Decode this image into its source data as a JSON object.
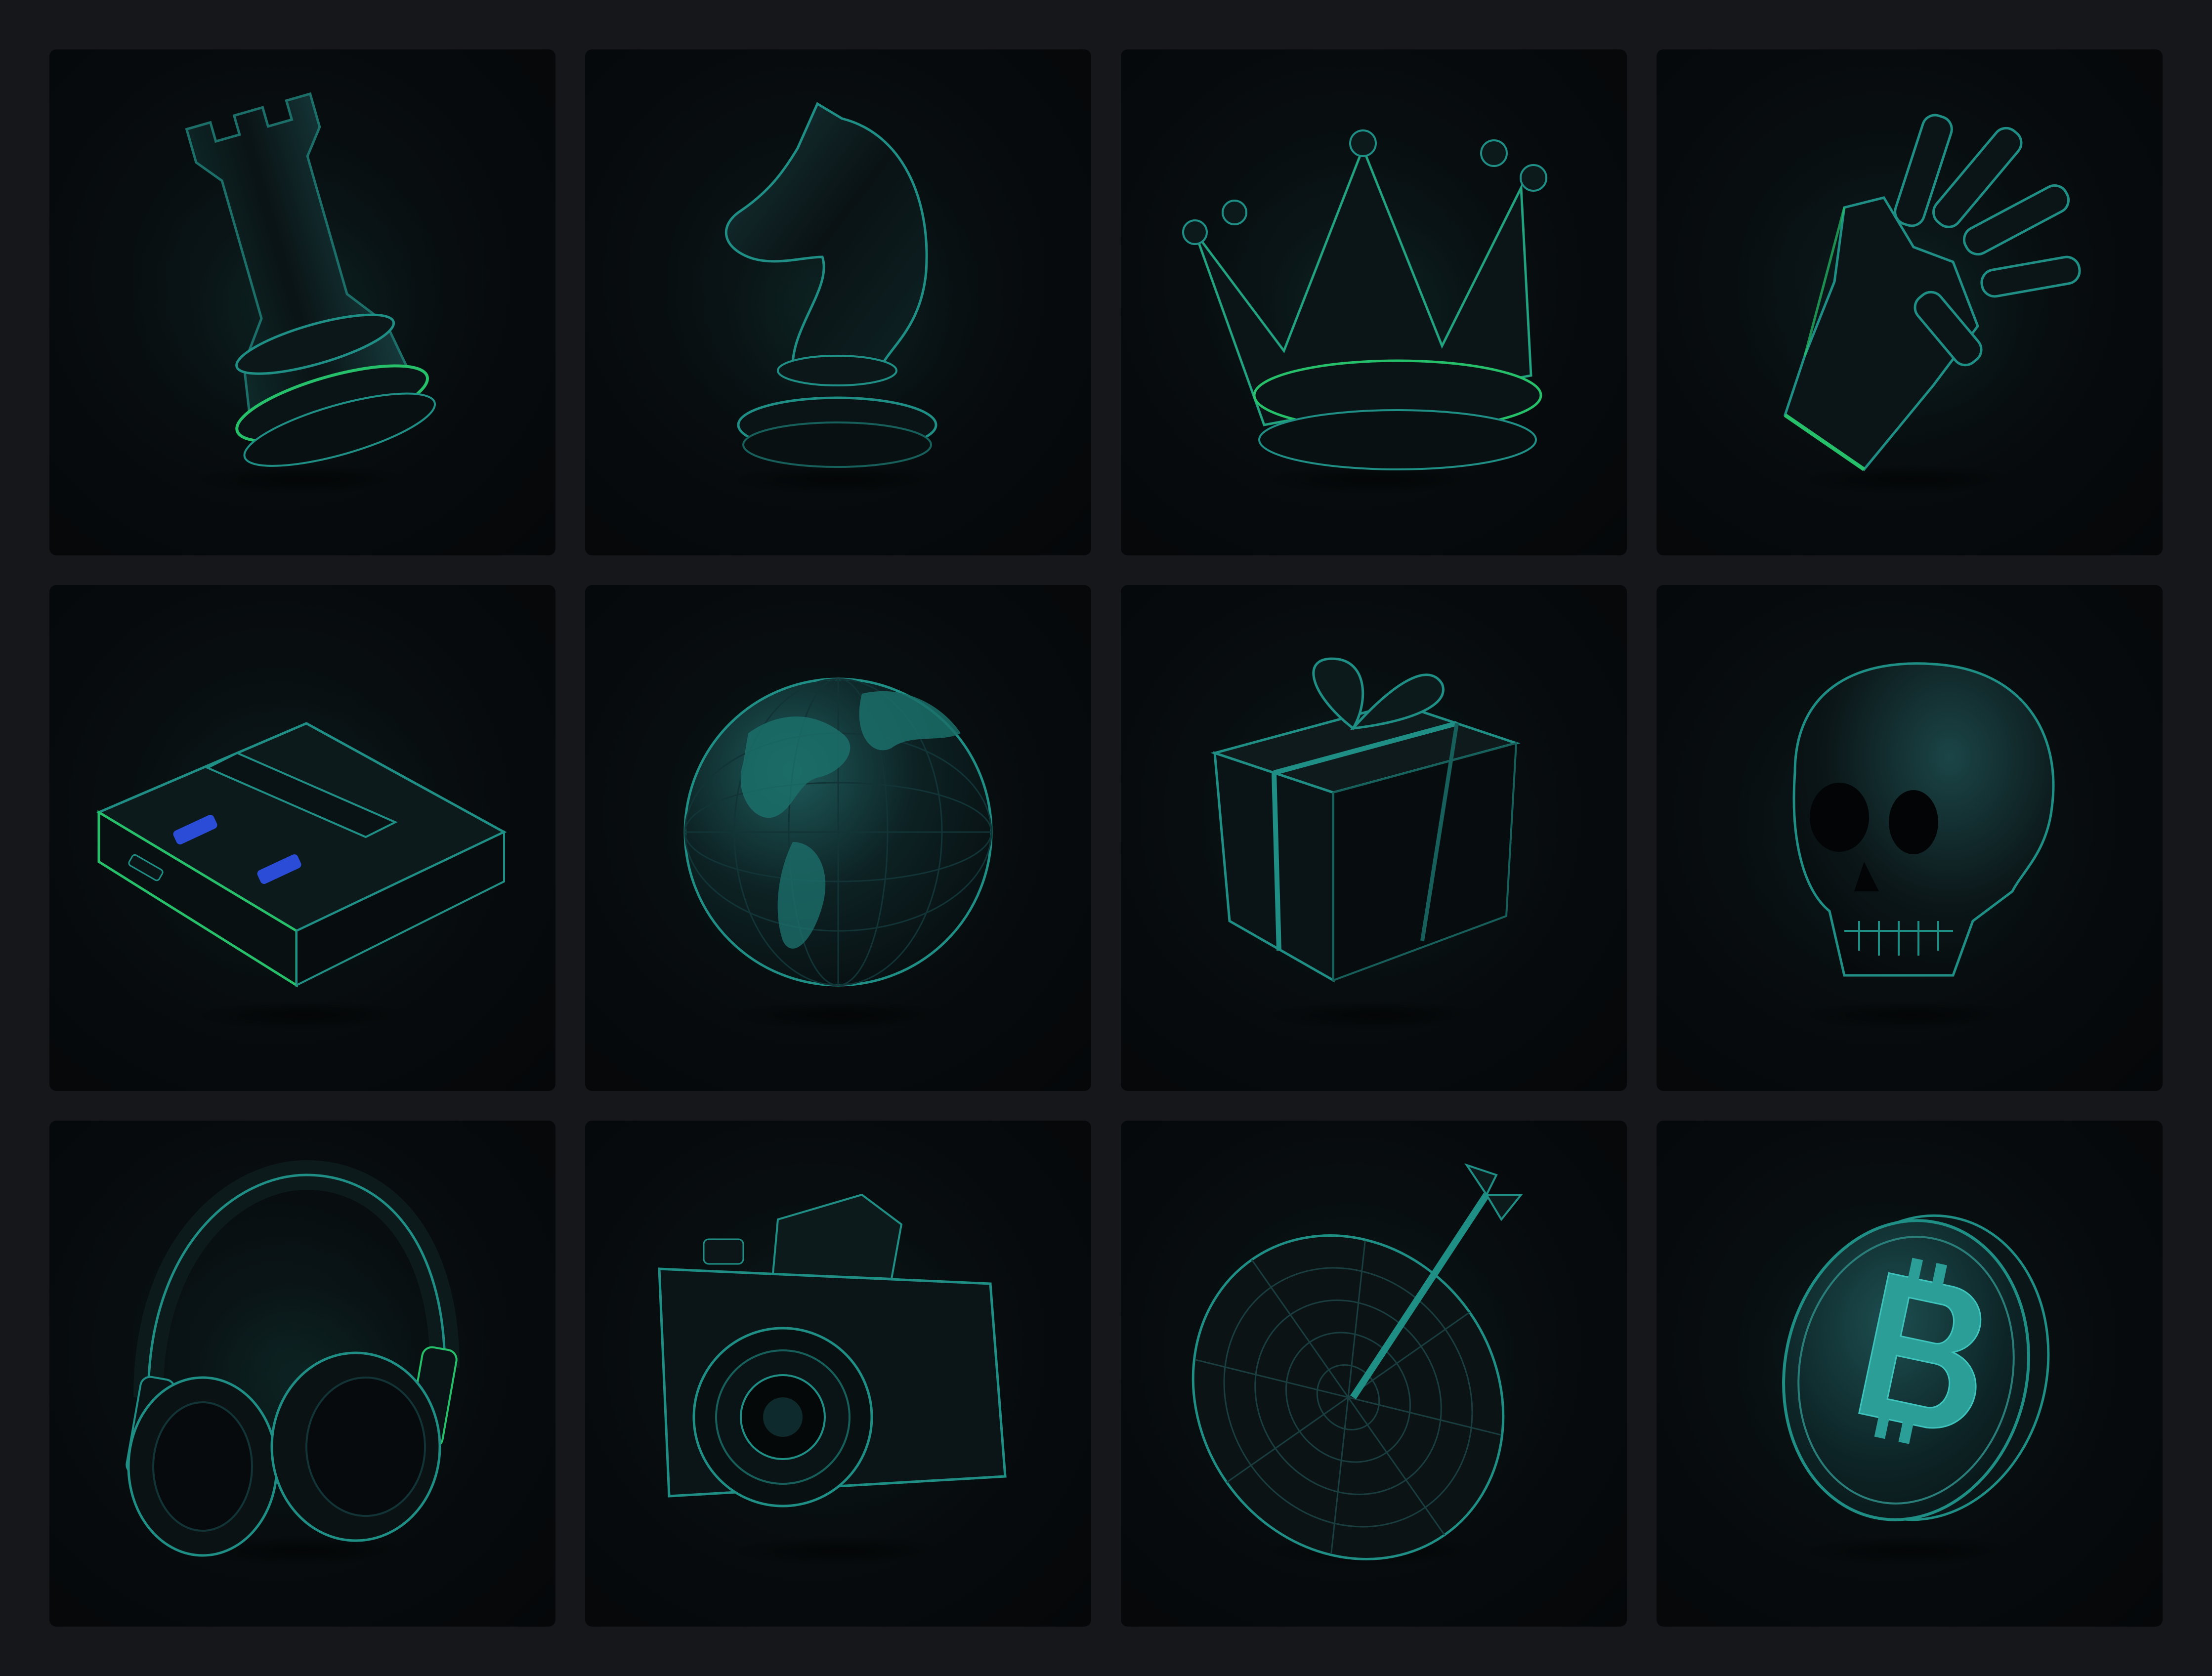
{
  "colors": {
    "page_background": "#15171a",
    "tile_background": "#06090b",
    "object_body": "#0c1214",
    "rim_teal": "#1f8f86",
    "rim_green": "#27c06a",
    "accent_blue": "#2a4cd6"
  },
  "icons": [
    {
      "name": "chess-rook-icon"
    },
    {
      "name": "chess-knight-icon"
    },
    {
      "name": "crown-icon"
    },
    {
      "name": "robot-hand-icon"
    },
    {
      "name": "game-console-icon"
    },
    {
      "name": "globe-icon"
    },
    {
      "name": "gift-box-icon"
    },
    {
      "name": "skull-icon"
    },
    {
      "name": "headphones-icon"
    },
    {
      "name": "camera-icon"
    },
    {
      "name": "dartboard-icon"
    },
    {
      "name": "bitcoin-coin-icon"
    }
  ]
}
